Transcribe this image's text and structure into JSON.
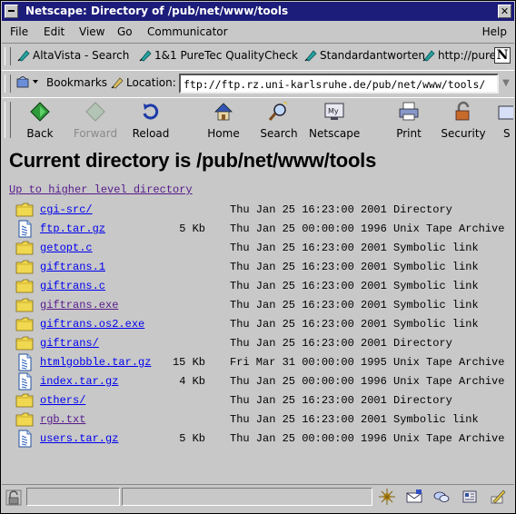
{
  "window": {
    "title": "Netscape: Directory of /pub/net/www/tools"
  },
  "menu": [
    "File",
    "Edit",
    "View",
    "Go",
    "Communicator",
    "Help"
  ],
  "personal_toolbar": {
    "items": [
      "AltaVista - Search",
      "1&1 PureTec QualityCheck",
      "Standardantworten",
      "http://purec"
    ]
  },
  "location_bar": {
    "bookmarks_label": "Bookmarks",
    "location_label": "Location:",
    "url": "ftp://ftp.rz.uni-karlsruhe.de/pub/net/www/tools/"
  },
  "navigation": {
    "buttons": [
      "Back",
      "Forward",
      "Reload",
      "Home",
      "Search",
      "Netscape",
      "Print",
      "Security",
      "S"
    ]
  },
  "page": {
    "heading": "Current directory is /pub/net/www/tools",
    "up_link": "Up to higher level directory",
    "files": [
      {
        "name": "cgi-src/",
        "size": "",
        "date": "Thu Jan 25 16:23:00 2001",
        "type": "Directory",
        "icon": "folder-icon",
        "visited": false
      },
      {
        "name": "ftp.tar.gz",
        "size": "5 Kb",
        "date": "Thu Jan 25 00:00:00 1996",
        "type": "Unix Tape Archive",
        "icon": "archive-file-icon",
        "visited": false
      },
      {
        "name": "getopt.c",
        "size": "",
        "date": "Thu Jan 25 16:23:00 2001",
        "type": "Symbolic link",
        "icon": "folder-icon",
        "visited": false
      },
      {
        "name": "giftrans.1",
        "size": "",
        "date": "Thu Jan 25 16:23:00 2001",
        "type": "Symbolic link",
        "icon": "folder-icon",
        "visited": false
      },
      {
        "name": "giftrans.c",
        "size": "",
        "date": "Thu Jan 25 16:23:00 2001",
        "type": "Symbolic link",
        "icon": "folder-icon",
        "visited": false
      },
      {
        "name": "giftrans.exe",
        "size": "",
        "date": "Thu Jan 25 16:23:00 2001",
        "type": "Symbolic link",
        "icon": "folder-icon",
        "visited": true
      },
      {
        "name": "giftrans.os2.exe",
        "size": "",
        "date": "Thu Jan 25 16:23:00 2001",
        "type": "Symbolic link",
        "icon": "folder-icon",
        "visited": false
      },
      {
        "name": "giftrans/",
        "size": "",
        "date": "Thu Jan 25 16:23:00 2001",
        "type": "Directory",
        "icon": "folder-icon",
        "visited": false
      },
      {
        "name": "htmlgobble.tar.gz",
        "size": "15 Kb",
        "date": "Fri Mar 31 00:00:00 1995",
        "type": "Unix Tape Archive",
        "icon": "archive-file-icon",
        "visited": false
      },
      {
        "name": "index.tar.gz",
        "size": "4 Kb",
        "date": "Thu Jan 25 00:00:00 1996",
        "type": "Unix Tape Archive",
        "icon": "archive-file-icon",
        "visited": false
      },
      {
        "name": "others/",
        "size": "",
        "date": "Thu Jan 25 16:23:00 2001",
        "type": "Directory",
        "icon": "folder-icon",
        "visited": false
      },
      {
        "name": "rgb.txt",
        "size": "",
        "date": "Thu Jan 25 16:23:00 2001",
        "type": "Symbolic link",
        "icon": "folder-icon",
        "visited": true
      },
      {
        "name": "users.tar.gz",
        "size": "5 Kb",
        "date": "Thu Jan 25 00:00:00 1996",
        "type": "Unix Tape Archive",
        "icon": "archive-file-icon",
        "visited": false
      }
    ]
  },
  "colors": {
    "titlebar": "#1c1c7a",
    "chrome": "#c8c8c8",
    "link_unvisited": "#0000ee",
    "link_visited": "#551a8b"
  }
}
